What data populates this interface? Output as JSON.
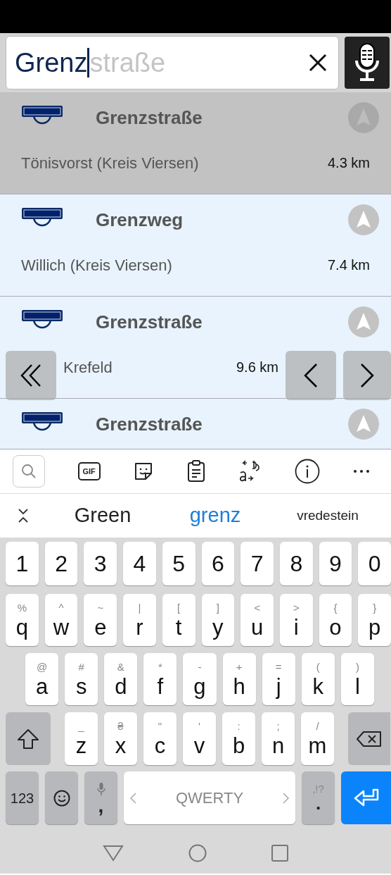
{
  "search": {
    "value": "Grenz",
    "completion": "straße"
  },
  "results": [
    {
      "title": "Grenzstraße",
      "subtitle": "Tönisvorst (Kreis Viersen)",
      "distance": "4.3 km",
      "selected": true
    },
    {
      "title": "Grenzweg",
      "subtitle": "Willich (Kreis Viersen)",
      "distance": "7.4 km",
      "selected": false
    },
    {
      "title": "Grenzstraße",
      "subtitle": "Krefeld",
      "distance": "9.6 km",
      "selected": false
    },
    {
      "title": "Grenzstraße",
      "selected": false
    }
  ],
  "keyboard_toolbar": [
    {
      "kind": "search"
    },
    {
      "kind": "gif",
      "label": "GIF"
    },
    {
      "kind": "sticker"
    },
    {
      "kind": "clipboard"
    },
    {
      "kind": "translate"
    },
    {
      "kind": "info"
    },
    {
      "kind": "more"
    }
  ],
  "suggestions": [
    {
      "text": "Green",
      "selected": false,
      "kind": "word"
    },
    {
      "text": "grenz",
      "selected": true,
      "kind": "word"
    },
    {
      "text": "vredestein",
      "selected": false,
      "kind": "long"
    }
  ],
  "keyboard": {
    "number_row": [
      "1",
      "2",
      "3",
      "4",
      "5",
      "6",
      "7",
      "8",
      "9",
      "0"
    ],
    "top_row": [
      {
        "label": "q",
        "hint": "%"
      },
      {
        "label": "w",
        "hint": "^"
      },
      {
        "label": "e",
        "hint": "~"
      },
      {
        "label": "r",
        "hint": "|"
      },
      {
        "label": "t",
        "hint": "["
      },
      {
        "label": "y",
        "hint": "]"
      },
      {
        "label": "u",
        "hint": "<"
      },
      {
        "label": "i",
        "hint": ">"
      },
      {
        "label": "o",
        "hint": "{"
      },
      {
        "label": "p",
        "hint": "}"
      }
    ],
    "middle_row": [
      {
        "label": "a",
        "hint": "@"
      },
      {
        "label": "s",
        "hint": "#"
      },
      {
        "label": "d",
        "hint": "&"
      },
      {
        "label": "f",
        "hint": "*"
      },
      {
        "label": "g",
        "hint": "-"
      },
      {
        "label": "h",
        "hint": "+"
      },
      {
        "label": "j",
        "hint": "="
      },
      {
        "label": "k",
        "hint": "("
      },
      {
        "label": "l",
        "hint": ")"
      }
    ],
    "bottom_row": [
      {
        "label": "z",
        "hint": "_"
      },
      {
        "label": "x",
        "hint": "₴"
      },
      {
        "label": "c",
        "hint": "\""
      },
      {
        "label": "v",
        "hint": "'"
      },
      {
        "label": "b",
        "hint": ":"
      },
      {
        "label": "n",
        "hint": ";"
      },
      {
        "label": "m",
        "hint": "/"
      }
    ],
    "symbols_key": "123",
    "comma_key": ",",
    "space_key": "QWERTY",
    "period_key": ".",
    "period_hint": ",!?"
  }
}
